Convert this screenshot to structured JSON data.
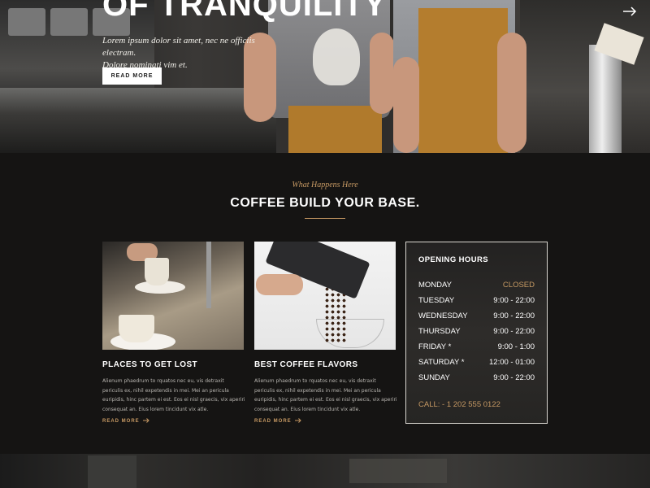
{
  "hero": {
    "title": "OF TRANQUILITY",
    "subtitle_line1": "Lorem ipsum dolor sit amet, nec ne officiis electram.",
    "subtitle_line2": "Dolore nominati vim et.",
    "button_label": "READ MORE",
    "next_icon": "arrow-right-icon"
  },
  "section": {
    "kicker": "What Happens Here",
    "title": "COFFEE BUILD YOUR BASE."
  },
  "cards": [
    {
      "title": "PLACES TO GET LOST",
      "text": "Alienum phaedrum to rquatos nec eu, vis detraxit periculis ex, nihil expetendis in mei. Mei an pericula euripidis, hinc partem ei est. Eos ei nisl graecis, vix aperiri consequat an. Eius lorem tincidunt vix atle.",
      "link": "READ MORE"
    },
    {
      "title": "BEST COFFEE FLAVORS",
      "text": "Alienum phaedrum to rquatos nec eu, vis detraxit periculis ex, nihil expetendis in mei. Mei an pericula euripidis, hinc partem ei est. Eos ei nisl graecis, vix aperiri consequat an. Eius lorem tincidunt vix atle.",
      "link": "READ MORE"
    }
  ],
  "hours": {
    "title": "OPENING HOURS",
    "rows": [
      {
        "day": "MONDAY",
        "time": "CLOSED"
      },
      {
        "day": "TUESDAY",
        "time": "9:00 - 22:00"
      },
      {
        "day": "WEDNESDAY",
        "time": "9:00 - 22:00"
      },
      {
        "day": "THURSDAY",
        "time": "9:00 - 22:00"
      },
      {
        "day": "FRIDAY *",
        "time": "9:00 - 1:00"
      },
      {
        "day": "SATURDAY *",
        "time": "12:00 - 01:00"
      },
      {
        "day": "SUNDAY",
        "time": "9:00 - 22:00"
      }
    ],
    "call": "CALL: - 1 202 555 0122"
  },
  "colors": {
    "accent": "#c69963",
    "background": "#151413"
  }
}
